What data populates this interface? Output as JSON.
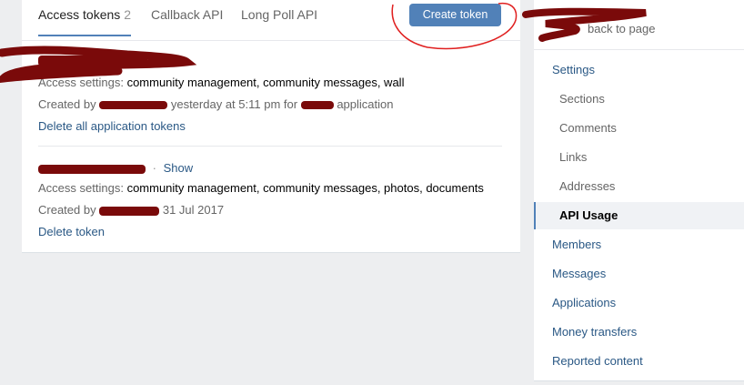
{
  "tabs": [
    {
      "label": "Access tokens",
      "count": "2",
      "active": true
    },
    {
      "label": "Callback API",
      "active": false
    },
    {
      "label": "Long Poll API",
      "active": false
    }
  ],
  "create_token_label": "Create token",
  "tokens": [
    {
      "access_label": "Access settings:",
      "access_value": "community management, community messages, wall",
      "created_prefix": "Created by",
      "created_suffix": "yesterday at 5:11 pm for",
      "created_app": "application",
      "action_label": "Delete all application tokens"
    },
    {
      "show_label": "Show",
      "dot": "·",
      "access_label": "Access settings:",
      "access_value": "community management, community messages, photos, documents",
      "created_prefix": "Created by",
      "created_suffix": "31 Jul 2017",
      "action_label": "Delete token"
    }
  ],
  "sidebar": {
    "back_label": "back to page",
    "items": [
      {
        "label": "Settings",
        "level": "top"
      },
      {
        "label": "Sections",
        "level": "sub"
      },
      {
        "label": "Comments",
        "level": "sub"
      },
      {
        "label": "Links",
        "level": "sub"
      },
      {
        "label": "Addresses",
        "level": "sub"
      },
      {
        "label": "API Usage",
        "level": "sub",
        "active": true
      },
      {
        "label": "Members",
        "level": "top"
      },
      {
        "label": "Messages",
        "level": "top"
      },
      {
        "label": "Applications",
        "level": "top"
      },
      {
        "label": "Money transfers",
        "level": "top"
      },
      {
        "label": "Reported content",
        "level": "top"
      }
    ]
  },
  "colors": {
    "accent": "#5181b8",
    "link": "#2a5885",
    "redaction": "#7a0a0a",
    "annotation": "#e02020"
  }
}
